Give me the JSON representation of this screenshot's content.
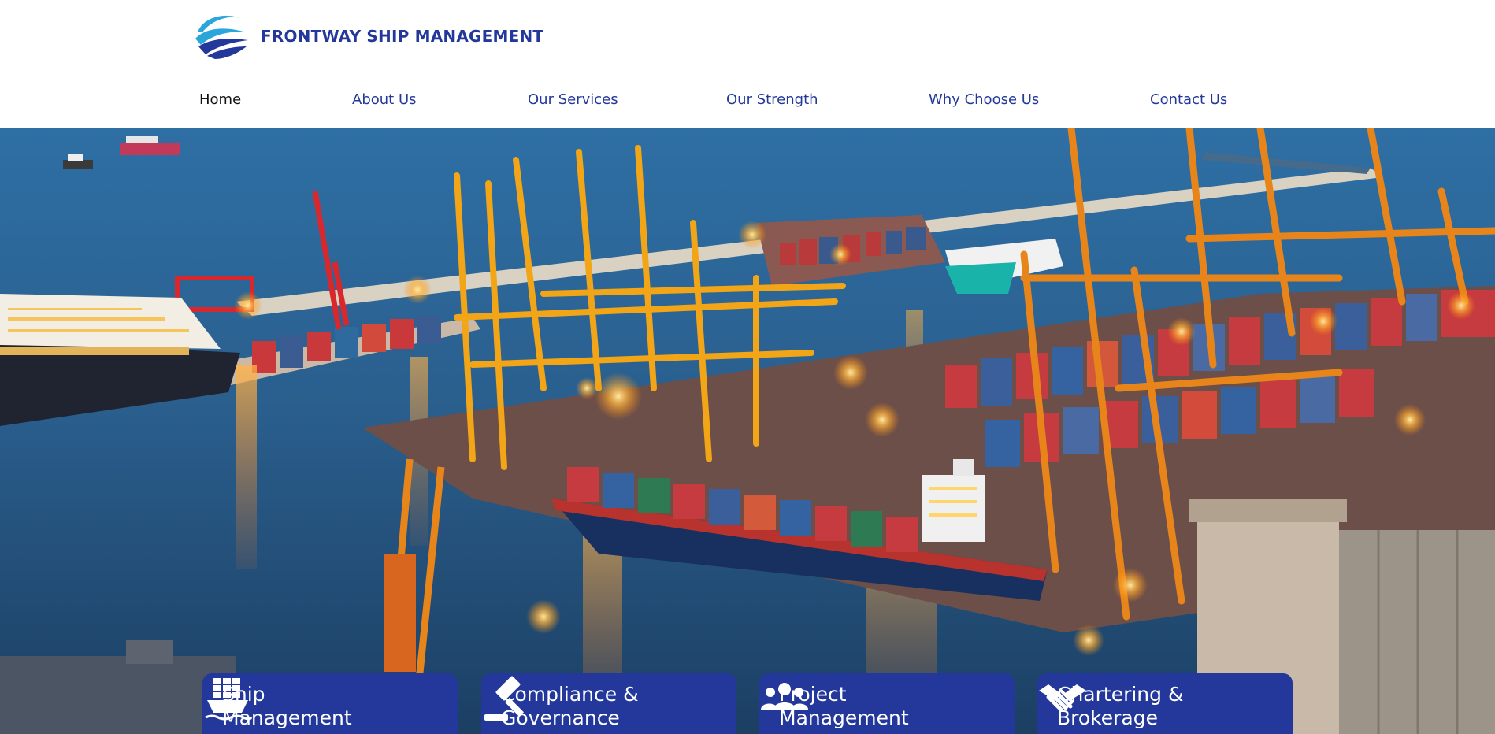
{
  "brand": {
    "name": "FRONTWAY SHIP MANAGEMENT",
    "logo_icon": "waves-logo-icon",
    "color": "#23389a"
  },
  "nav": {
    "items": [
      {
        "label": "Home",
        "active": true
      },
      {
        "label": "About Us",
        "active": false
      },
      {
        "label": "Our Services",
        "active": false
      },
      {
        "label": "Our Strength",
        "active": false
      },
      {
        "label": "Why Choose Us",
        "active": false
      },
      {
        "label": "Contact Us",
        "active": false
      }
    ],
    "color": "#23389a",
    "active_color": "#111111"
  },
  "hero": {
    "scene": "port-at-dusk-image"
  },
  "services": {
    "card_color": "#23389a",
    "items": [
      {
        "title": "Ship\nManagement",
        "icon": "cargo-ship-icon"
      },
      {
        "title": "Compliance &\nGovernance",
        "icon": "gavel-icon"
      },
      {
        "title": "Project\nManagement",
        "icon": "team-icon"
      },
      {
        "title": "Chartering &\nBrokerage",
        "icon": "handshake-icon"
      }
    ]
  }
}
